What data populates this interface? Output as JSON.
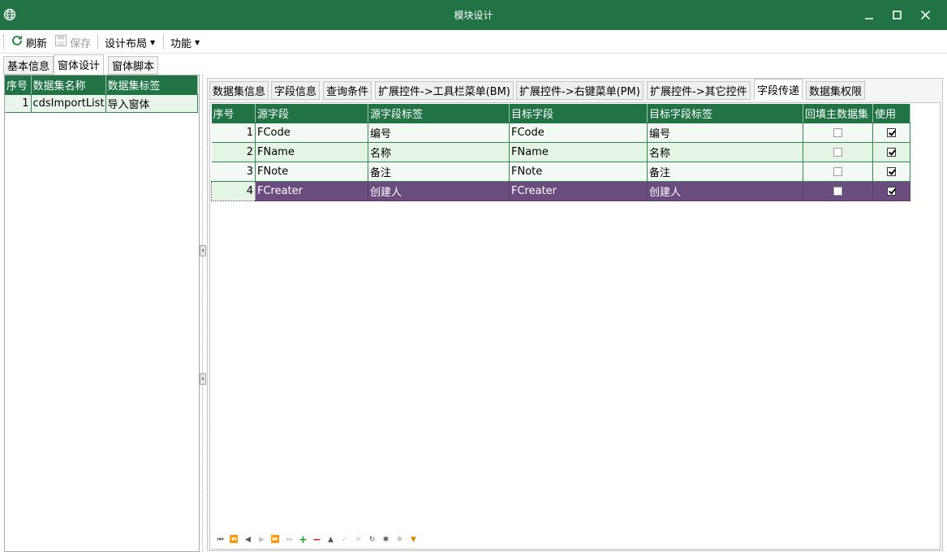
{
  "window": {
    "title": "模块设计",
    "app_icon": "globe-icon",
    "buttons": [
      "minimize",
      "maximize",
      "close"
    ]
  },
  "toolbar": {
    "refresh_label": "刷新",
    "save_label": "保存",
    "layout_label": "设计布局",
    "function_label": "功能"
  },
  "main_tabs": [
    {
      "label": "基本信息",
      "active": false
    },
    {
      "label": "窗体设计",
      "active": true
    },
    {
      "label": "窗体脚本",
      "active": false
    }
  ],
  "left_grid": {
    "columns": [
      "序号",
      "数据集名称",
      "数据集标签"
    ],
    "rows": [
      {
        "no": "1",
        "name": "cdsImportList",
        "label": "导入窗体"
      }
    ]
  },
  "sub_tabs": [
    {
      "label": "数据集信息",
      "active": false
    },
    {
      "label": "字段信息",
      "active": false
    },
    {
      "label": "查询条件",
      "active": false
    },
    {
      "label": "扩展控件->工具栏菜单(BM)",
      "active": false
    },
    {
      "label": "扩展控件->右键菜单(PM)",
      "active": false
    },
    {
      "label": "扩展控件->其它控件",
      "active": false
    },
    {
      "label": "字段传递",
      "active": true
    },
    {
      "label": "数据集权限",
      "active": false
    }
  ],
  "field_grid": {
    "columns": [
      "序号",
      "源字段",
      "源字段标签",
      "目标字段",
      "目标字段标签",
      "回填主数据集",
      "使用"
    ],
    "rows": [
      {
        "no": "1",
        "src": "FCode",
        "src_label": "编号",
        "dst": "FCode",
        "dst_label": "编号",
        "backfill": false,
        "use": true
      },
      {
        "no": "2",
        "src": "FName",
        "src_label": "名称",
        "dst": "FName",
        "dst_label": "名称",
        "backfill": false,
        "use": true
      },
      {
        "no": "3",
        "src": "FNote",
        "src_label": "备注",
        "dst": "FNote",
        "dst_label": "备注",
        "backfill": false,
        "use": true
      },
      {
        "no": "4",
        "src": "FCreater",
        "src_label": "创建人",
        "dst": "FCreater",
        "dst_label": "创建人",
        "backfill": false,
        "use": true
      }
    ],
    "selected_row": 4
  },
  "navigator": [
    "first-icon",
    "prev-page-icon",
    "prev-icon",
    "next-icon",
    "next-page-icon",
    "last-icon",
    "add-icon",
    "remove-icon",
    "edit-icon",
    "post-icon",
    "cancel-icon",
    "refresh-icon",
    "save-bookmark-icon",
    "goto-bookmark-icon",
    "filter-icon"
  ],
  "colors": {
    "title_bar": "#217346",
    "grid_header": "#217346",
    "row_light": "#f3faf3",
    "row_dark": "#e5f5e5",
    "selected_row": "#6b4c7e"
  }
}
